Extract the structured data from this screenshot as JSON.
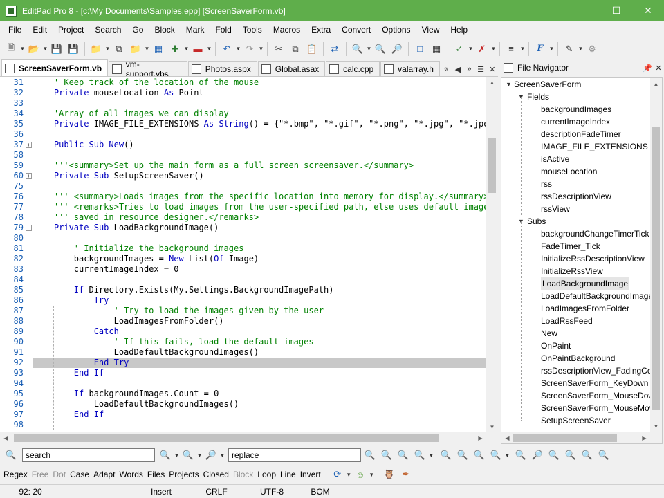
{
  "window": {
    "title": "EditPad Pro 8 - [c:\\My Documents\\Samples.epp] [ScreenSaverForm.vb]",
    "accent": "#5fae4b"
  },
  "menu": [
    "File",
    "Edit",
    "Project",
    "Search",
    "Go",
    "Block",
    "Mark",
    "Fold",
    "Tools",
    "Macros",
    "Extra",
    "Convert",
    "Options",
    "View",
    "Help"
  ],
  "tabs": [
    {
      "label": "ScreenSaverForm.vb",
      "active": true
    },
    {
      "label": "vm-support.vbs",
      "active": false
    },
    {
      "label": "Photos.aspx",
      "active": false
    },
    {
      "label": "Global.asax",
      "active": false
    },
    {
      "label": "calc.cpp",
      "active": false
    },
    {
      "label": "valarray.h",
      "active": false
    }
  ],
  "editor": {
    "lines": [
      {
        "n": "31",
        "text": "    ' Keep track of the location of the mouse"
      },
      {
        "n": "32",
        "text": "    Private mouseLocation As Point"
      },
      {
        "n": "33",
        "text": ""
      },
      {
        "n": "34",
        "text": "    'Array of all images we can display"
      },
      {
        "n": "35",
        "text": "    Private IMAGE_FILE_EXTENSIONS As String() = {\"*.bmp\", \"*.gif\", \"*.png\", \"*.jpg\", \"*.jpeg\"}"
      },
      {
        "n": "36",
        "text": ""
      },
      {
        "n": "37",
        "text": "    Public Sub New()"
      },
      {
        "n": "58",
        "text": ""
      },
      {
        "n": "59",
        "text": "    '''<summary>Set up the main form as a full screen screensaver.</summary>"
      },
      {
        "n": "60",
        "text": "    Private Sub SetupScreenSaver()"
      },
      {
        "n": "75",
        "text": ""
      },
      {
        "n": "76",
        "text": "    ''' <summary>Loads images from the specific location into memory for display.</summary>"
      },
      {
        "n": "77",
        "text": "    ''' <remarks>Tries to load images from the user-specified path, else uses default images"
      },
      {
        "n": "78",
        "text": "    ''' saved in resource designer.</remarks>"
      },
      {
        "n": "79",
        "text": "    Private Sub LoadBackgroundImage()"
      },
      {
        "n": "80",
        "text": ""
      },
      {
        "n": "81",
        "text": "        ' Initialize the background images"
      },
      {
        "n": "82",
        "text": "        backgroundImages = New List(Of Image)"
      },
      {
        "n": "83",
        "text": "        currentImageIndex = 0"
      },
      {
        "n": "84",
        "text": ""
      },
      {
        "n": "85",
        "text": "        If Directory.Exists(My.Settings.BackgroundImagePath)"
      },
      {
        "n": "86",
        "text": "            Try"
      },
      {
        "n": "87",
        "text": "                ' Try to load the images given by the user"
      },
      {
        "n": "88",
        "text": "                LoadImagesFromFolder()"
      },
      {
        "n": "89",
        "text": "            Catch"
      },
      {
        "n": "90",
        "text": "                ' If this fails, load the default images"
      },
      {
        "n": "91",
        "text": "                LoadDefaultBackgroundImages()"
      },
      {
        "n": "92",
        "text": "            End Try"
      },
      {
        "n": "93",
        "text": "        End If"
      },
      {
        "n": "94",
        "text": ""
      },
      {
        "n": "95",
        "text": "        If backgroundImages.Count = 0"
      },
      {
        "n": "96",
        "text": "            LoadDefaultBackgroundImages()"
      },
      {
        "n": "97",
        "text": "        End If"
      },
      {
        "n": "98",
        "text": ""
      }
    ]
  },
  "navigator": {
    "title": "File Navigator",
    "root": "ScreenSaverForm",
    "fields_label": "Fields",
    "fields": [
      "backgroundImages",
      "currentImageIndex",
      "descriptionFadeTimer",
      "IMAGE_FILE_EXTENSIONS",
      "isActive",
      "mouseLocation",
      "rss",
      "rssDescriptionView",
      "rssView"
    ],
    "subs_label": "Subs",
    "subs": [
      "backgroundChangeTimerTick",
      "FadeTimer_Tick",
      "InitializeRssDescriptionView",
      "InitializeRssView",
      "LoadBackgroundImage",
      "LoadDefaultBackgroundImages",
      "LoadImagesFromFolder",
      "LoadRssFeed",
      "New",
      "OnPaint",
      "OnPaintBackground",
      "rssDescriptionView_FadingComplete",
      "ScreenSaverForm_KeyDown",
      "ScreenSaverForm_MouseDown",
      "ScreenSaverForm_MouseMove",
      "SetupScreenSaver"
    ],
    "selected": "LoadBackgroundImage"
  },
  "search": {
    "search_value": "search",
    "replace_value": "replace"
  },
  "options": [
    {
      "label": "Regex",
      "enabled": true
    },
    {
      "label": "Free",
      "enabled": false
    },
    {
      "label": "Dot",
      "enabled": false
    },
    {
      "label": "Case",
      "enabled": true
    },
    {
      "label": "Adapt",
      "enabled": true
    },
    {
      "label": "Words",
      "enabled": true
    },
    {
      "label": "Files",
      "enabled": true
    },
    {
      "label": "Projects",
      "enabled": true
    },
    {
      "label": "Closed",
      "enabled": true
    },
    {
      "label": "Block",
      "enabled": false
    },
    {
      "label": "Loop",
      "enabled": true
    },
    {
      "label": "Line",
      "enabled": true
    },
    {
      "label": "Invert",
      "enabled": true
    }
  ],
  "status": {
    "position": "92: 20",
    "mode": "Insert",
    "line_break": "CRLF",
    "encoding": "UTF-8",
    "bom": "BOM"
  }
}
